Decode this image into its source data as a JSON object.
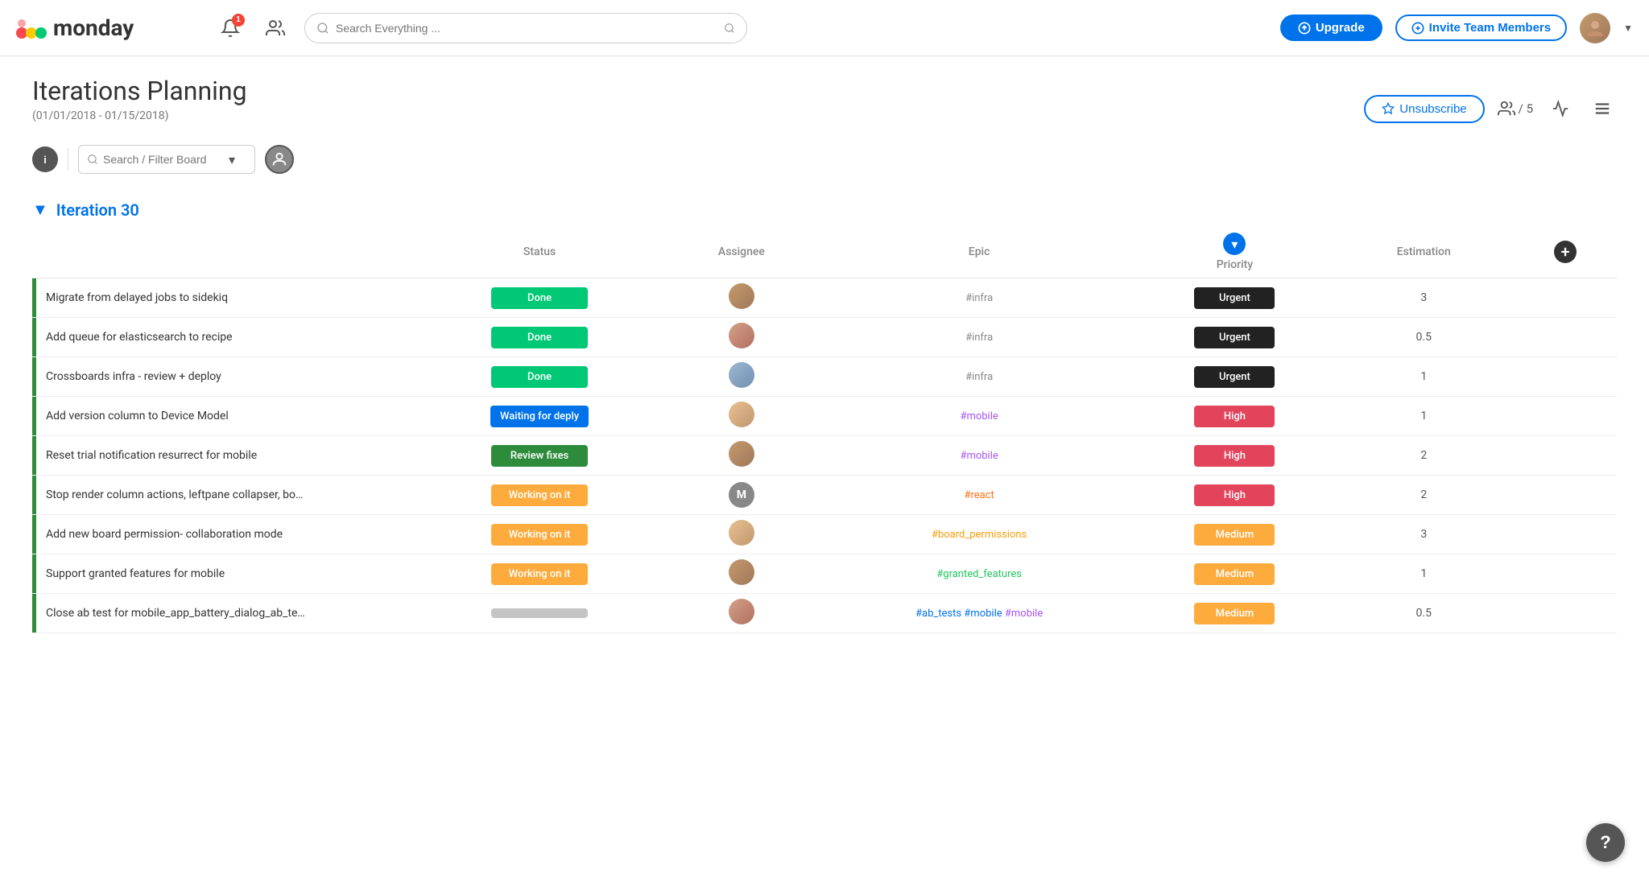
{
  "app": {
    "logo_text": "monday",
    "nav": {
      "search_placeholder": "Search Everything ...",
      "notification_badge": "1",
      "upgrade_label": "Upgrade",
      "invite_label": "Invite Team Members"
    }
  },
  "page": {
    "title": "Iterations Planning",
    "subtitle": "(01/01/2018 - 01/15/2018)",
    "unsubscribe_label": "Unsubscribe",
    "members_count": "/ 5",
    "filter_placeholder": "Search / Filter Board"
  },
  "iteration": {
    "title": "Iteration 30",
    "columns": {
      "status": "Status",
      "assignee": "Assignee",
      "epic": "Epic",
      "priority": "Priority",
      "estimation": "Estimation"
    },
    "rows": [
      {
        "task": "Migrate from delayed jobs to sidekiq",
        "status": "Done",
        "status_class": "status-done",
        "epic": "#infra",
        "epic_class": "epic-infra",
        "priority": "Urgent",
        "priority_class": "priority-urgent",
        "estimation": "3",
        "avatar_class": "av1"
      },
      {
        "task": "Add queue for elasticsearch to recipe",
        "status": "Done",
        "status_class": "status-done",
        "epic": "#infra",
        "epic_class": "epic-infra",
        "priority": "Urgent",
        "priority_class": "priority-urgent",
        "estimation": "0.5",
        "avatar_class": "av2"
      },
      {
        "task": "Crossboards infra - review + deploy",
        "status": "Done",
        "status_class": "status-done",
        "epic": "#infra",
        "epic_class": "epic-infra",
        "priority": "Urgent",
        "priority_class": "priority-urgent",
        "estimation": "1",
        "avatar_class": "av3"
      },
      {
        "task": "Add version column to Device Model",
        "status": "Waiting for deply",
        "status_class": "status-waiting",
        "epic": "#mobile",
        "epic_class": "epic-mobile",
        "priority": "High",
        "priority_class": "priority-high",
        "estimation": "1",
        "avatar_class": "av4"
      },
      {
        "task": "Reset trial notification resurrect for mobile",
        "status": "Review fixes",
        "status_class": "status-review",
        "epic": "#mobile",
        "epic_class": "epic-mobile",
        "priority": "High",
        "priority_class": "priority-high",
        "estimation": "2",
        "avatar_class": "av1"
      },
      {
        "task": "Stop render column actions, leftpane collapser, bo…",
        "status": "Working on it",
        "status_class": "status-working",
        "epic": "#react",
        "epic_class": "epic-react",
        "priority": "High",
        "priority_class": "priority-high",
        "estimation": "2",
        "avatar_class": "avM",
        "avatar_letter": "M"
      },
      {
        "task": "Add new board permission- collaboration mode",
        "status": "Working on it",
        "status_class": "status-working",
        "epic": "#board_permissions",
        "epic_class": "epic-board",
        "priority": "Medium",
        "priority_class": "priority-medium",
        "estimation": "3",
        "avatar_class": "av4"
      },
      {
        "task": "Support granted features for mobile",
        "status": "Working on it",
        "status_class": "status-working",
        "epic": "#granted_features",
        "epic_class": "epic-granted",
        "priority": "Medium",
        "priority_class": "priority-medium",
        "estimation": "1",
        "avatar_class": "av1"
      },
      {
        "task": "Close ab test for mobile_app_battery_dialog_ab_te…",
        "status": "",
        "status_class": "status-blank",
        "epic": "#ab_tests #mobile",
        "epic_class": "epic-abtests",
        "priority": "Medium",
        "priority_class": "priority-medium",
        "estimation": "0.5",
        "avatar_class": "av2",
        "epic2": "#mobile",
        "epic2_class": "epic-mobile"
      }
    ]
  },
  "help": {
    "label": "?"
  }
}
